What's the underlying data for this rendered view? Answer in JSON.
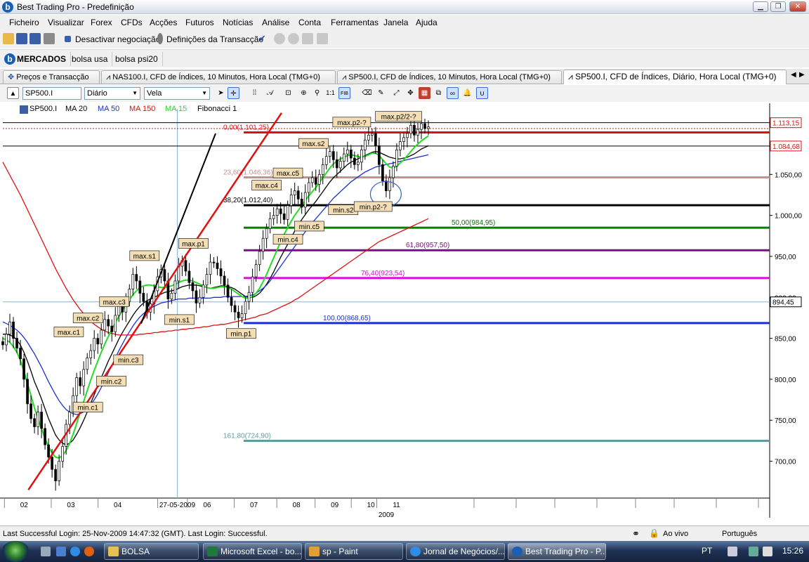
{
  "window": {
    "title": "Best Trading Pro - Predefinição"
  },
  "menu": [
    "Ficheiro",
    "Visualizar",
    "Forex",
    "CFDs",
    "Acções",
    "Futuros",
    "Notícias",
    "Análise",
    "Conta",
    "Ferramentas",
    "Janela",
    "Ajuda"
  ],
  "toolbar": {
    "deactivate_label": "Desactivar negociação",
    "settings_label": "Definições da Transacção"
  },
  "markets": {
    "header": "MERCADOS",
    "tabs": [
      "bolsa usa",
      "bolsa psi20"
    ]
  },
  "chart_tabs": [
    {
      "label": "Preços e Transacção"
    },
    {
      "label": "NAS100.I, CFD de Índices, 10 Minutos, Hora Local (TMG+0)"
    },
    {
      "label": "SP500.I, CFD de Índices, 10 Minutos, Hora Local (TMG+0)"
    },
    {
      "label": "SP500.I, CFD de Índices, Diário, Hora Local (TMG+0)"
    }
  ],
  "chart_toolbar": {
    "symbol": "SP500.I",
    "timeframe": "Diário",
    "style": "Vela",
    "fib": "FIB"
  },
  "legend": {
    "symbol": "SP500.I",
    "ma20": "MA 20",
    "ma50": "MA 50",
    "ma150": "MA 150",
    "ma15": "MA 15",
    "fib": "Fibonacci 1",
    "colors": {
      "ma20": "#000000",
      "ma50": "#1b2fd6",
      "ma150": "#e01010",
      "ma15": "#22dd22"
    }
  },
  "chart_data": {
    "type": "candlestick",
    "title": "",
    "xlabel": "2009",
    "ylabel": "",
    "ylim": [
      655,
      1130
    ],
    "y_ticks": [
      "1.050,00",
      "1.000,00",
      "950,00",
      "900,00",
      "850,00",
      "800,00",
      "750,00",
      "700,00"
    ],
    "y_tick_values": [
      1050,
      1000,
      950,
      900,
      850,
      800,
      750,
      700
    ],
    "x_ticks": [
      "02",
      "03",
      "04",
      "27-05-2009",
      "06",
      "07",
      "08",
      "09",
      "10",
      "11"
    ],
    "price_tags": [
      {
        "label": "1.113,15",
        "value": 1113.15,
        "color": "#e01010"
      },
      {
        "label": "1.084,68",
        "value": 1084.68,
        "color": "#e01010"
      },
      {
        "label": "894,45",
        "value": 894.45,
        "color": "#000000"
      }
    ],
    "fibonacci": [
      {
        "label": "0,00(1.101,25)",
        "value": 1101.25,
        "color": "#e01010"
      },
      {
        "label": "23,60(1.046,36)",
        "value": 1046.36,
        "color": "#c89090"
      },
      {
        "label": "38,20(1.012,40)",
        "value": 1012.4,
        "color": "#000000"
      },
      {
        "label": "50,00(984,95)",
        "value": 984.95,
        "color": "#0a7a0a"
      },
      {
        "label": "61,80(957,50)",
        "value": 957.5,
        "color": "#7a107a"
      },
      {
        "label": "76,40(923,54)",
        "value": 923.54,
        "color": "#e010e0"
      },
      {
        "label": "100,00(868,65)",
        "value": 868.65,
        "color": "#1b2fd6"
      },
      {
        "label": "161,80(724,90)",
        "value": 724.9,
        "color": "#5f9ea0"
      }
    ],
    "annotations": [
      {
        "label": "max.c1",
        "t": 0.155,
        "v": 857
      },
      {
        "label": "min.c1",
        "t": 0.2,
        "v": 765
      },
      {
        "label": "max.c2",
        "t": 0.2,
        "v": 874
      },
      {
        "label": "min.c2",
        "t": 0.255,
        "v": 797
      },
      {
        "label": "max.c3",
        "t": 0.262,
        "v": 894
      },
      {
        "label": "min.c3",
        "t": 0.295,
        "v": 823
      },
      {
        "label": "max.s1",
        "t": 0.333,
        "v": 950
      },
      {
        "label": "min.s1",
        "t": 0.415,
        "v": 872
      },
      {
        "label": "max.p1",
        "t": 0.448,
        "v": 965
      },
      {
        "label": "min.p1",
        "t": 0.56,
        "v": 855
      },
      {
        "label": "max.c4",
        "t": 0.62,
        "v": 1036
      },
      {
        "label": "min.c4",
        "t": 0.67,
        "v": 970
      },
      {
        "label": "max.c5",
        "t": 0.67,
        "v": 1051
      },
      {
        "label": "min.c5",
        "t": 0.72,
        "v": 986
      },
      {
        "label": "max.s2",
        "t": 0.73,
        "v": 1087
      },
      {
        "label": "min.s2",
        "t": 0.8,
        "v": 1006
      },
      {
        "label": "max.p2-?",
        "t": 0.82,
        "v": 1113
      },
      {
        "label": "min.p2-?",
        "t": 0.87,
        "v": 1010
      },
      {
        "label": "max.p2/2-?",
        "t": 0.93,
        "v": 1120
      }
    ],
    "series": [
      {
        "name": "SP500.I",
        "values": [
          842,
          855,
          870,
          850,
          838,
          825,
          800,
          770,
          752,
          742,
          760,
          740,
          720,
          705,
          690,
          676,
          700,
          718,
          745,
          760,
          780,
          802,
          792,
          812,
          826,
          835,
          850,
          843,
          860,
          873,
          865,
          858,
          878,
          890,
          882,
          895,
          910,
          928,
          920,
          905,
          895,
          882,
          892,
          908,
          925,
          934,
          920,
          898,
          905,
          920,
          938,
          945,
          932,
          918,
          908,
          893,
          900,
          915,
          928,
          943,
          942,
          935,
          926,
          915,
          900,
          890,
          882,
          875,
          880,
          895,
          906,
          925,
          940,
          956,
          972,
          984,
          996,
          1000,
          1008,
          1002,
          995,
          1012,
          1025,
          1030,
          1020,
          1010,
          1028,
          1040,
          1046,
          1038,
          1050,
          1062,
          1072,
          1078,
          1068,
          1058,
          1066,
          1075,
          1080,
          1070,
          1062,
          1065,
          1080,
          1092,
          1098,
          1100,
          1085,
          1062,
          1042,
          1030,
          1046,
          1060,
          1080,
          1090,
          1095,
          1100,
          1110,
          1098,
          1105,
          1112,
          1106,
          1108
        ]
      },
      {
        "name": "MA 20",
        "values": [
          855,
          855,
          854,
          852,
          848,
          842,
          833,
          822,
          810,
          797,
          787,
          776,
          764,
          752,
          742,
          732,
          726,
          722,
          720,
          722,
          726,
          733,
          741,
          750,
          760,
          771,
          781,
          792,
          802,
          812,
          822,
          831,
          840,
          849,
          857,
          864,
          871,
          878,
          884,
          889,
          893,
          896,
          898,
          900,
          902,
          904,
          906,
          907,
          908,
          909,
          911,
          913,
          914,
          915,
          915,
          915,
          914,
          913,
          912,
          911,
          912,
          913,
          914,
          914,
          913,
          912,
          910,
          907,
          904,
          901,
          900,
          900,
          902,
          905,
          910,
          916,
          923,
          931,
          940,
          949,
          957,
          965,
          973,
          981,
          988,
          995,
          1001,
          1007,
          1012,
          1017,
          1023,
          1029,
          1035,
          1041,
          1046,
          1050,
          1054,
          1058,
          1062,
          1065,
          1067,
          1069,
          1071,
          1073,
          1075,
          1077,
          1078,
          1077,
          1075,
          1073,
          1071,
          1070,
          1069,
          1069,
          1070,
          1071,
          1073,
          1075,
          1078,
          1081,
          1083,
          1085
        ]
      },
      {
        "name": "MA 50",
        "values": [
          870,
          868,
          866,
          863,
          860,
          856,
          851,
          845,
          838,
          831,
          823,
          815,
          806,
          797,
          789,
          781,
          774,
          768,
          763,
          760,
          758,
          757,
          758,
          760,
          764,
          769,
          775,
          782,
          790,
          799,
          808,
          817,
          826,
          835,
          843,
          851,
          858,
          865,
          871,
          876,
          880,
          884,
          887,
          889,
          891,
          893,
          894,
          895,
          896,
          897,
          898,
          898,
          898,
          899,
          899,
          899,
          899,
          899,
          899,
          899,
          900,
          900,
          900,
          901,
          901,
          901,
          901,
          901,
          901,
          901,
          902,
          903,
          905,
          908,
          911,
          915,
          920,
          926,
          932,
          938,
          944,
          950,
          956,
          962,
          968,
          974,
          980,
          986,
          991,
          996,
          1001,
          1006,
          1011,
          1016,
          1021,
          1025,
          1029,
          1033,
          1037,
          1041,
          1044,
          1047,
          1050,
          1053,
          1055,
          1057,
          1059,
          1060,
          1061,
          1062,
          1063,
          1064,
          1065,
          1066,
          1067,
          1068,
          1069,
          1070,
          1071,
          1072,
          1073,
          1074
        ]
      },
      {
        "name": "MA 150",
        "values": [
          1065,
          1057,
          1049,
          1041,
          1033,
          1025,
          1016,
          1007,
          998,
          989,
          980,
          971,
          962,
          953,
          944,
          935,
          927,
          919,
          911,
          904,
          897,
          891,
          885,
          880,
          875,
          871,
          867,
          864,
          861,
          859,
          857,
          856,
          855,
          854,
          854,
          854,
          854,
          854,
          854,
          855,
          855,
          856,
          856,
          857,
          857,
          858,
          858,
          859,
          859,
          860,
          860,
          861,
          861,
          862,
          862,
          863,
          863,
          864,
          864,
          865,
          866,
          866,
          867,
          867,
          868,
          869,
          870,
          871,
          872,
          873,
          874,
          875,
          876,
          878,
          879,
          880,
          882,
          884,
          886,
          888,
          890,
          892,
          894,
          897,
          899,
          902,
          905,
          908,
          911,
          914,
          917,
          920,
          923,
          926,
          929,
          932,
          935,
          938,
          941,
          944,
          947,
          950,
          953,
          956,
          959,
          962,
          965,
          968,
          970,
          972,
          974,
          976,
          978,
          980,
          982,
          984,
          986,
          988,
          990,
          992,
          994,
          996
        ]
      },
      {
        "name": "MA 15",
        "values": [
          850,
          848,
          845,
          840,
          833,
          823,
          810,
          795,
          780,
          765,
          752,
          740,
          728,
          718,
          710,
          705,
          704,
          707,
          713,
          722,
          733,
          746,
          760,
          773,
          786,
          799,
          811,
          822,
          833,
          843,
          852,
          861,
          869,
          877,
          884,
          891,
          897,
          903,
          908,
          912,
          914,
          915,
          915,
          914,
          913,
          912,
          912,
          913,
          914,
          916,
          918,
          920,
          921,
          921,
          920,
          918,
          916,
          914,
          912,
          911,
          911,
          912,
          913,
          913,
          912,
          910,
          907,
          904,
          901,
          899,
          899,
          901,
          905,
          911,
          919,
          928,
          938,
          948,
          958,
          968,
          977,
          985,
          993,
          1000,
          1006,
          1012,
          1018,
          1024,
          1029,
          1034,
          1040,
          1046,
          1052,
          1058,
          1063,
          1066,
          1069,
          1071,
          1073,
          1074,
          1073,
          1072,
          1071,
          1072,
          1074,
          1076,
          1076,
          1073,
          1068,
          1063,
          1059,
          1058,
          1060,
          1064,
          1068,
          1073,
          1078,
          1083,
          1087,
          1091,
          1094,
          1097
        ]
      }
    ],
    "trendlines": [
      {
        "name": "support",
        "color": "#e01010",
        "from": {
          "t": 0.06,
          "v": 665
        },
        "to": {
          "t": 0.655,
          "v": 1125
        }
      },
      {
        "name": "impulse",
        "color": "#000000",
        "from": {
          "t": 0.325,
          "v": 868
        },
        "to": {
          "t": 0.5,
          "v": 1100
        }
      }
    ]
  },
  "status": {
    "login": "Last Successful Login: 25-Nov-2009 14:47:32 (GMT). Last Login: Successful.",
    "mode": "Ao vivo",
    "language": "Português"
  },
  "taskbar": {
    "items": [
      "BOLSA",
      "Microsoft Excel - bo...",
      "sp - Paint",
      "Jornal de Negócios/...",
      "Best Trading Pro - P..."
    ],
    "lang": "PT",
    "time": "15:26"
  }
}
